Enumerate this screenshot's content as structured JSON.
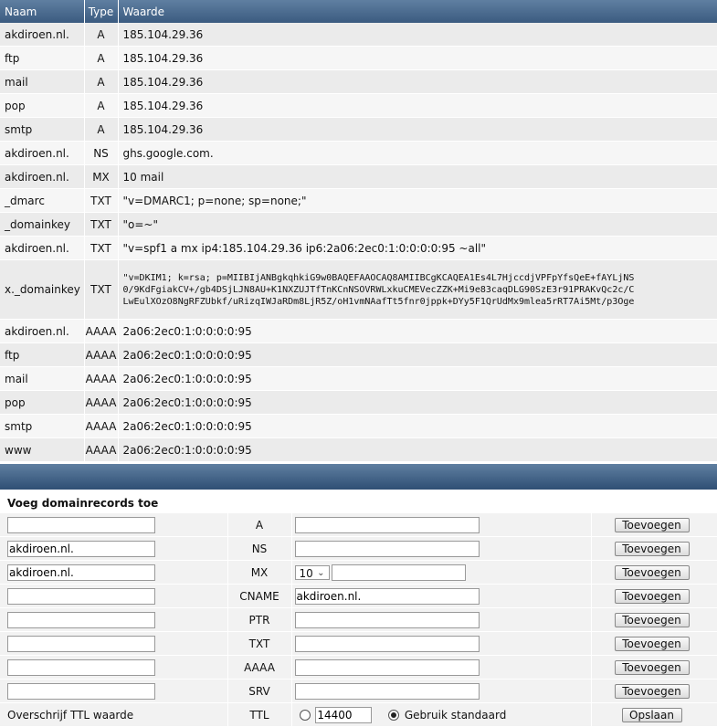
{
  "columns": [
    "Naam",
    "Type",
    "Waarde"
  ],
  "records": [
    {
      "name": "akdiroen.nl.",
      "type": "A",
      "value": "185.104.29.36"
    },
    {
      "name": "ftp",
      "type": "A",
      "value": "185.104.29.36"
    },
    {
      "name": "mail",
      "type": "A",
      "value": "185.104.29.36"
    },
    {
      "name": "pop",
      "type": "A",
      "value": "185.104.29.36"
    },
    {
      "name": "smtp",
      "type": "A",
      "value": "185.104.29.36"
    },
    {
      "name": "akdiroen.nl.",
      "type": "NS",
      "value": "ghs.google.com."
    },
    {
      "name": "akdiroen.nl.",
      "type": "MX",
      "value": "10 mail"
    },
    {
      "name": "_dmarc",
      "type": "TXT",
      "value": "\"v=DMARC1; p=none; sp=none;\""
    },
    {
      "name": "_domainkey",
      "type": "TXT",
      "value": "\"o=~\""
    },
    {
      "name": "akdiroen.nl.",
      "type": "TXT",
      "value": "\"v=spf1 a mx ip4:185.104.29.36 ip6:2a06:2ec0:1:0:0:0:0:95 ~all\""
    },
    {
      "name": "x._domainkey",
      "type": "TXT",
      "value_lines": [
        "\"v=DKIM1; k=rsa; p=MIIBIjANBgkqhkiG9w0BAQEFAAOCAQ8AMIIBCgKCAQEA1Es4L7HjccdjVPFpYfsQeE+fAYLjNS",
        "0/9KdFgiakCV+/gb4DSjLJN8AU+K1NXZUJTfTnKCnNSOVRWLxkuCMEVecZZK+Mi9e83caqDLG90SzE3r91PRAKvQc2c/C",
        "LwEulXOzO8NgRFZUbkf/uRizqIWJaRDm8LjR5Z/oH1vmNAafTt5fnr0jppk+DYy5F1QrUdMx9mlea5rRT7Ai5Mt/p3Oge"
      ]
    },
    {
      "name": "akdiroen.nl.",
      "type": "AAAA",
      "value": "2a06:2ec0:1:0:0:0:0:95"
    },
    {
      "name": "ftp",
      "type": "AAAA",
      "value": "2a06:2ec0:1:0:0:0:0:95"
    },
    {
      "name": "mail",
      "type": "AAAA",
      "value": "2a06:2ec0:1:0:0:0:0:95"
    },
    {
      "name": "pop",
      "type": "AAAA",
      "value": "2a06:2ec0:1:0:0:0:0:95"
    },
    {
      "name": "smtp",
      "type": "AAAA",
      "value": "2a06:2ec0:1:0:0:0:0:95"
    },
    {
      "name": "www",
      "type": "AAAA",
      "value": "2a06:2ec0:1:0:0:0:0:95"
    }
  ],
  "add_section": {
    "title": "Voeg domainrecords toe",
    "button_label": "Toevoegen",
    "rows": [
      {
        "type": "A",
        "name_value": "",
        "value": ""
      },
      {
        "type": "NS",
        "name_value": "akdiroen.nl.",
        "value": ""
      },
      {
        "type": "MX",
        "name_value": "akdiroen.nl.",
        "priority": "10",
        "value": ""
      },
      {
        "type": "CNAME",
        "name_value": "",
        "value": "akdiroen.nl."
      },
      {
        "type": "PTR",
        "name_value": "",
        "value": ""
      },
      {
        "type": "TXT",
        "name_value": "",
        "value": ""
      },
      {
        "type": "AAAA",
        "name_value": "",
        "value": ""
      },
      {
        "type": "SRV",
        "name_value": "",
        "value": ""
      }
    ],
    "ttl": {
      "label": "Overschrijf TTL waarde",
      "type_label": "TTL",
      "custom_value": "14400",
      "default_label": "Gebruik standaard",
      "selected": "default",
      "save_label": "Opslaan"
    }
  }
}
